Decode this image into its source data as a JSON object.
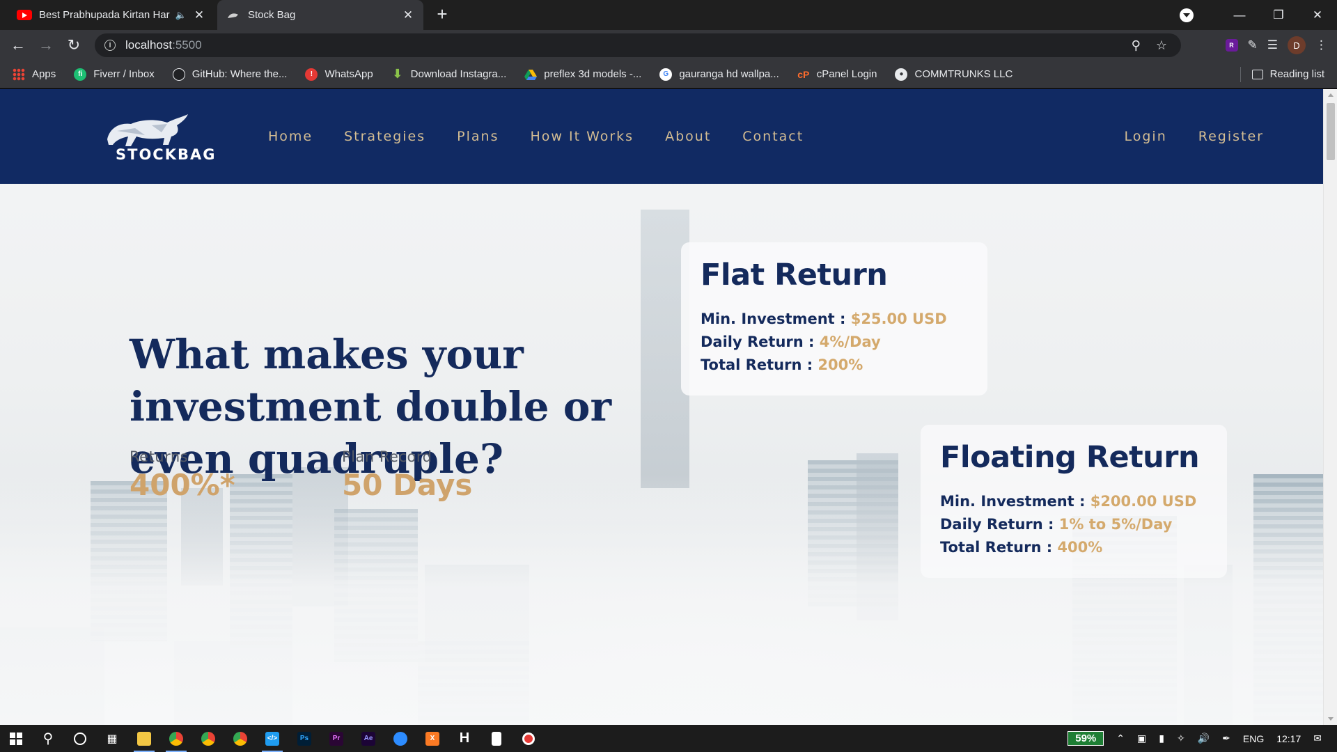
{
  "browser": {
    "tabs": [
      {
        "title": "Best Prabhupada Kirtan Hare",
        "icon": "youtube-icon",
        "audio": "speaker-icon"
      },
      {
        "title": "Stock Bag",
        "icon": "stockbag-favicon"
      }
    ],
    "new_tab": "+",
    "address": {
      "host": "localhost",
      "port": ":5500"
    },
    "bookmarks": [
      {
        "label": "Apps",
        "icon": "apps-grid-icon"
      },
      {
        "label": "Fiverr / Inbox",
        "icon": "fiverr-icon"
      },
      {
        "label": "GitHub: Where the...",
        "icon": "github-icon"
      },
      {
        "label": "WhatsApp",
        "icon": "whatsapp-icon"
      },
      {
        "label": "Download Instagra...",
        "icon": "download-icon"
      },
      {
        "label": "preflex 3d models -...",
        "icon": "google-drive-icon"
      },
      {
        "label": "gauranga hd wallpa...",
        "icon": "google-icon"
      },
      {
        "label": "cPanel Login",
        "icon": "cpanel-icon"
      },
      {
        "label": "COMMTRUNKS LLC",
        "icon": "globe-icon"
      }
    ],
    "reading_list": "Reading list",
    "profile_initial": "D"
  },
  "site": {
    "logo_text": "STOCKBAG",
    "nav": [
      "Home",
      "Strategies",
      "Plans",
      "How It Works",
      "About",
      "Contact"
    ],
    "auth": [
      "Login",
      "Register"
    ],
    "hero": {
      "title": "What makes your investment double or even quadruple?",
      "stats": [
        {
          "label": "Returns",
          "value": "400%*"
        },
        {
          "label": "Plan Record",
          "value": "50 Days"
        }
      ]
    },
    "plans": [
      {
        "name": "Flat Return",
        "rows": [
          {
            "label": "Min. Investment :",
            "value": "$25.00 USD"
          },
          {
            "label": "Daily Return :",
            "value": "4%/Day"
          },
          {
            "label": "Total Return :",
            "value": "200%"
          }
        ]
      },
      {
        "name": "Floating Return",
        "rows": [
          {
            "label": "Min. Investment :",
            "value": "$200.00 USD"
          },
          {
            "label": "Daily Return :",
            "value": "1% to 5%/Day"
          },
          {
            "label": "Total Return :",
            "value": "400%"
          }
        ]
      }
    ],
    "colors": {
      "nav_bg": "#112a63",
      "gold": "#d4a96c",
      "navy_text": "#142a5c"
    }
  },
  "taskbar": {
    "battery": "59%",
    "language": "ENG",
    "time": "12:17"
  }
}
